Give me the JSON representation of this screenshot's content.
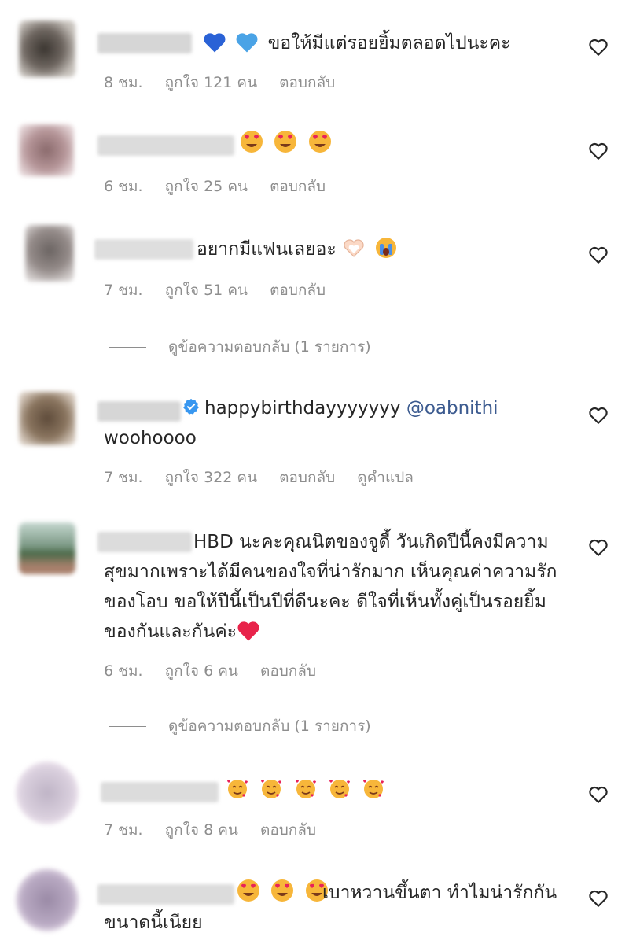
{
  "comments": [
    {
      "text": "ขอให้มีแต่รอยยิ้มตลอดไปนะคะ",
      "emoji_prefix": [
        "blue-heart-emoji",
        "light-blue-heart-emoji"
      ],
      "time": "8 ชม.",
      "likes": "ถูกใจ 121 คน",
      "reply": "ตอบกลับ"
    },
    {
      "text": "",
      "emoji_prefix": [
        "heart-eyes-emoji",
        "heart-eyes-emoji",
        "heart-eyes-emoji"
      ],
      "time": "6 ชม.",
      "likes": "ถูกใจ 25 คน",
      "reply": "ตอบกลับ"
    },
    {
      "text": "อยากมีแฟนเลยอะ",
      "emoji_suffix": [
        "heart-hands-emoji",
        "crying-face-emoji"
      ],
      "time": "7 ชม.",
      "likes": "ถูกใจ 51 คน",
      "reply": "ตอบกลับ"
    },
    {
      "text": "happybirthdayyyyyyy",
      "mention": "@oabnithi",
      "text_line2": "woohoooo",
      "verified": true,
      "time": "7 ชม.",
      "likes": "ถูกใจ 322 คน",
      "reply": "ตอบกลับ",
      "translate": "ดูคำแปล"
    },
    {
      "text": "HBD นะคะคุณนิตของจูดี้ วันเกิดปีนี้คงมีความสุขมากเพราะได้มีคนของใจที่น่ารักมาก เห็นคุณค่าความรักของโอบ ขอให้ปีนี้เป็นปีที่ดีนะคะ ดีใจที่เห็นทั้งคู่เป็นรอยยิ้มของกันและกันค่ะ",
      "emoji_suffix": [
        "red-heart-emoji"
      ],
      "time": "6 ชม.",
      "likes": "ถูกใจ 6 คน",
      "reply": "ตอบกลับ"
    },
    {
      "text": "",
      "emoji_prefix": [
        "smiling-face-hearts-emoji",
        "smiling-face-hearts-emoji",
        "smiling-face-hearts-emoji",
        "smiling-face-hearts-emoji",
        "smiling-face-hearts-emoji"
      ],
      "time": "7 ชม.",
      "likes": "ถูกใจ 8 คน",
      "reply": "ตอบกลับ"
    },
    {
      "text": "เบาหวานขึ้นตา ทำไมน่ารักกันขนาดนี้เนียย",
      "emoji_prefix": [
        "heart-eyes-emoji",
        "heart-eyes-emoji",
        "heart-eyes-emoji"
      ]
    }
  ],
  "view_replies": [
    "ดูข้อความตอบกลับ (1 รายการ)",
    "ดูข้อความตอบกลับ (1 รายการ)"
  ],
  "colors": {
    "meta": "#8e8e8e",
    "mention": "#3b5a8f",
    "verified": "#3897f0"
  }
}
